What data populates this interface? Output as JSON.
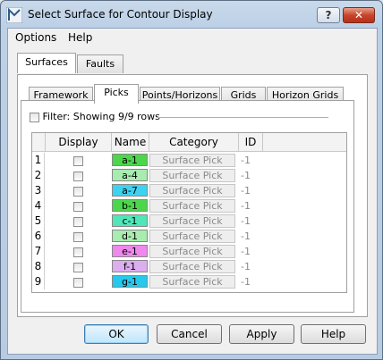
{
  "window": {
    "title": "Select Surface for Contour Display",
    "help_label": "?",
    "close_label": "✕"
  },
  "menubar": {
    "items": [
      {
        "label": "Options"
      },
      {
        "label": "Help"
      }
    ]
  },
  "outer_tabs": [
    {
      "label": "Surfaces",
      "active": true
    },
    {
      "label": "Faults",
      "active": false
    }
  ],
  "inner_tabs": [
    {
      "label": "Framework",
      "active": false
    },
    {
      "label": "Picks",
      "active": true
    },
    {
      "label": "Points/Horizons",
      "active": false
    },
    {
      "label": "Grids",
      "active": false
    },
    {
      "label": "Horizon Grids",
      "active": false
    }
  ],
  "filter": {
    "label": "Filter: Showing 9/9 rows",
    "checked": false
  },
  "table": {
    "columns": {
      "display": "Display",
      "name": "Name",
      "category": "Category",
      "id": "ID"
    },
    "rows": [
      {
        "num": "1",
        "name": "a-1",
        "color": "#4cd64c",
        "category": "Surface Pick",
        "id": "-1"
      },
      {
        "num": "2",
        "name": "a-4",
        "color": "#a9ecb0",
        "category": "Surface Pick",
        "id": "-1"
      },
      {
        "num": "3",
        "name": "a-7",
        "color": "#3fd2f0",
        "category": "Surface Pick",
        "id": "-1"
      },
      {
        "num": "4",
        "name": "b-1",
        "color": "#4cd64c",
        "category": "Surface Pick",
        "id": "-1"
      },
      {
        "num": "5",
        "name": "c-1",
        "color": "#50e6b8",
        "category": "Surface Pick",
        "id": "-1"
      },
      {
        "num": "6",
        "name": "d-1",
        "color": "#a9ecb0",
        "category": "Surface Pick",
        "id": "-1"
      },
      {
        "num": "7",
        "name": "e-1",
        "color": "#ee88ec",
        "category": "Surface Pick",
        "id": "-1"
      },
      {
        "num": "8",
        "name": "f-1",
        "color": "#dcaef0",
        "category": "Surface Pick",
        "id": "-1"
      },
      {
        "num": "9",
        "name": "g-1",
        "color": "#26c8ec",
        "category": "Surface Pick",
        "id": "-1"
      }
    ]
  },
  "buttons": {
    "ok": "OK",
    "cancel": "Cancel",
    "apply": "Apply",
    "help": "Help"
  }
}
